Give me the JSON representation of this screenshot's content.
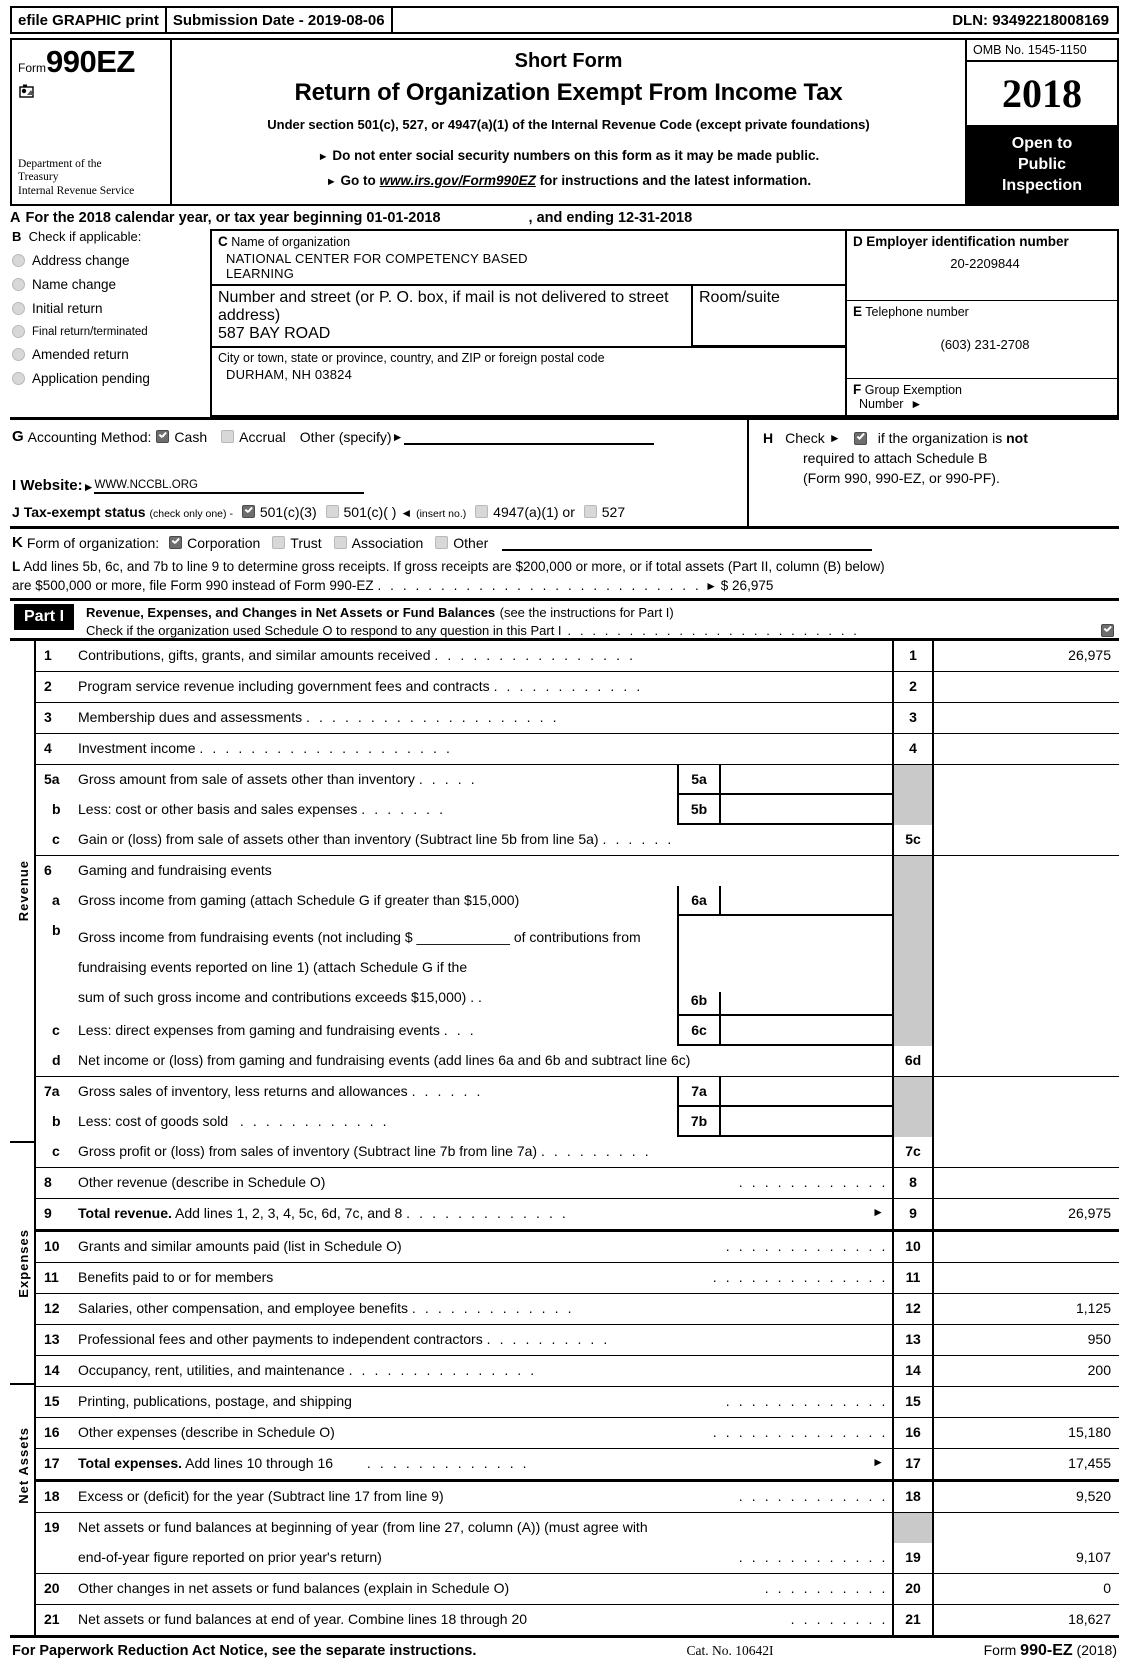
{
  "efile": {
    "graphic_print": "efile GRAPHIC print",
    "submission_date": "Submission Date - 2019-08-06",
    "dln": "DLN: 93492218008169"
  },
  "masthead": {
    "form_label": "Form",
    "form_number": "990EZ",
    "department_line1": "Department of the",
    "department_line2": "Treasury",
    "department_line3": "Internal Revenue Service",
    "short_form": "Short Form",
    "title": "Return of Organization Exempt From Income Tax",
    "under_section": "Under section 501(c), 527, or 4947(a)(1) of the Internal Revenue Code (except private foundations)",
    "bullet1": "Do not enter social security numbers on this form as it may be made public.",
    "bullet2_pre": "Go to ",
    "bullet2_link": "www.irs.gov/Form990EZ",
    "bullet2_post": " for instructions and the latest information.",
    "omb": "OMB No. 1545-1150",
    "year": "2018",
    "open_to": "Open to",
    "public": "Public",
    "inspection": "Inspection"
  },
  "lineA": {
    "letter": "A",
    "text_pre": "For the 2018 calendar year, or tax year beginning",
    "begin_date": "01-01-2018",
    "text_mid": ", and ending",
    "end_date": "12-31-2018"
  },
  "sectionB": {
    "letter": "B",
    "heading": "Check if applicable:",
    "items": [
      {
        "label": "Address change",
        "checked": false
      },
      {
        "label": "Name change",
        "checked": false
      },
      {
        "label": "Initial return",
        "checked": false
      },
      {
        "label": "Final return/terminated",
        "checked": false,
        "small": true
      },
      {
        "label": "Amended return",
        "checked": false
      },
      {
        "label": "Application pending",
        "checked": false
      }
    ]
  },
  "sectionC": {
    "letter": "C",
    "name_caption": "Name of organization",
    "org_name_line1": "NATIONAL CENTER FOR COMPETENCY BASED",
    "org_name_line2": "LEARNING",
    "street_caption": "Number and street (or P. O. box, if mail is not delivered to street address)",
    "room_caption": "Room/suite",
    "street": "587 BAY ROAD",
    "city_caption": "City or town, state or province, country, and ZIP or foreign postal code",
    "city": "DURHAM, NH  03824"
  },
  "sectionD": {
    "letter": "D",
    "caption": "Employer identification number",
    "value": "20-2209844"
  },
  "sectionE": {
    "letter": "E",
    "caption": "Telephone number",
    "value": "(603) 231-2708"
  },
  "sectionF": {
    "letter": "F",
    "caption_line1": "Group Exemption",
    "caption_line2": "Number"
  },
  "sectionG": {
    "letter": "G",
    "label": "Accounting Method:",
    "cash": "Cash",
    "cash_checked": true,
    "accrual": "Accrual",
    "accrual_checked": false,
    "other": "Other (specify)"
  },
  "sectionH": {
    "letter": "H",
    "check_label": "Check",
    "checked": true,
    "text1_pre": "if the organization is ",
    "text1_bold": "not",
    "text2": "required to attach Schedule B",
    "text3": "(Form 990, 990-EZ, or 990-PF)."
  },
  "sectionI": {
    "letter": "I",
    "label": "Website:",
    "value": "WWW.NCCBL.ORG"
  },
  "sectionJ": {
    "letter": "J",
    "label": "Tax-exempt status",
    "note": "(check only one) -",
    "opt1": "501(c)(3)",
    "opt1_checked": true,
    "opt2": "501(c)(   )",
    "opt2_checked": false,
    "insert": "(insert no.)",
    "opt3": "4947(a)(1) or",
    "opt3_checked": false,
    "opt4": "527",
    "opt4_checked": false
  },
  "sectionK": {
    "letter": "K",
    "label": "Form of organization:",
    "options": [
      {
        "label": "Corporation",
        "checked": true
      },
      {
        "label": "Trust",
        "checked": false
      },
      {
        "label": "Association",
        "checked": false
      },
      {
        "label": "Other",
        "checked": false
      }
    ]
  },
  "sectionL": {
    "letter": "L",
    "line1": "Add lines 5b, 6c, and 7b to line 9 to determine gross receipts. If gross receipts are $200,000 or more, or if total assets (Part II, column (B) below)",
    "line2": "are $500,000 or more, file Form 990 instead of Form 990-EZ",
    "amount_prefix": "$",
    "amount": "26,975"
  },
  "partI": {
    "tag": "Part I",
    "title": "Revenue, Expenses, and Changes in Net Assets or Fund Balances",
    "title_note": "(see the instructions for Part I)",
    "schedule_o_text": "Check if the organization used Schedule O to respond to any question in this Part I",
    "schedule_o_checked": true
  },
  "side_labels": {
    "revenue": "Revenue",
    "expenses": "Expenses",
    "net_assets": "Net Assets"
  },
  "revenue_lines": [
    {
      "no": "1",
      "desc": "Contributions, gifts, grants, and similar amounts received",
      "dots": ". . . . . . . . . . . . . . . .",
      "lno": "1",
      "amount": "26,975"
    },
    {
      "no": "2",
      "desc": "Program service revenue including government fees and contracts",
      "dots": ". . . . . . . . . . . .",
      "lno": "2",
      "amount": ""
    },
    {
      "no": "3",
      "desc": "Membership dues and assessments",
      "dots": ". . . . . . . . . . . . . . . . . . . .",
      "lno": "3",
      "amount": ""
    },
    {
      "no": "4",
      "desc": "Investment income",
      "dots": ". . . . . . . . . . . . . . . . . . . .",
      "lno": "4",
      "amount": ""
    },
    {
      "no": "5a",
      "desc": "Gross amount from sale of assets other than inventory",
      "dots": ". . . . .",
      "sub_no": "5a",
      "sub_amount": "",
      "lno": "",
      "gray": true,
      "amount": ""
    },
    {
      "no": "b",
      "desc": "Less: cost or other basis and sales expenses",
      "dots": ". . . . . . .",
      "sub_no": "5b",
      "sub_amount": "",
      "lno": "",
      "gray": true,
      "amount": ""
    },
    {
      "no": "c",
      "desc": "Gain or (loss) from sale of assets other than inventory (Subtract line 5b from line 5a)",
      "dots": ". . . . . .",
      "lno": "5c",
      "amount": ""
    },
    {
      "no": "6",
      "desc": "Gaming and fundraising events",
      "dots": "",
      "lno": "",
      "gray": true,
      "amount": ""
    },
    {
      "no": "a",
      "desc": "Gross income from gaming (attach Schedule G if greater than $15,000)",
      "dots": "",
      "sub_no": "6a",
      "sub_amount": "",
      "lno": "",
      "gray": true,
      "amount": ""
    },
    {
      "no": "b",
      "desc_multiline": [
        "Gross income from fundraising events (not including $ ____________ of contributions from",
        "fundraising events reported on line 1) (attach Schedule G if the",
        "sum of such gross income and contributions exceeds $15,000)     . ."
      ],
      "sub_no": "6b",
      "sub_amount": "",
      "lno": "",
      "gray": true,
      "amount": ""
    },
    {
      "no": "c",
      "desc": "Less: direct expenses from gaming and fundraising events",
      "dots": ". . .",
      "sub_no": "6c",
      "sub_amount": "",
      "lno": "",
      "gray": true,
      "amount": ""
    },
    {
      "no": "d",
      "desc": "Net income or (loss) from gaming and fundraising events (add lines 6a and 6b and subtract line 6c)",
      "dots": "",
      "lno": "6d",
      "amount": ""
    },
    {
      "no": "7a",
      "desc": "Gross sales of inventory, less returns and allowances",
      "dots": ". . . . . .",
      "sub_no": "7a",
      "sub_amount": "",
      "lno": "",
      "gray": true,
      "amount": ""
    },
    {
      "no": "b",
      "desc": "Less: cost of goods sold",
      "dots": ". . . . . . . . . . . .",
      "sub_no": "7b",
      "sub_amount": "",
      "lno": "",
      "gray": true,
      "amount": ""
    },
    {
      "no": "c",
      "desc": "Gross profit or (loss) from sales of inventory (Subtract line 7b from line 7a)",
      "dots": ". . . . . . . . .",
      "lno": "7c",
      "amount": ""
    },
    {
      "no": "8",
      "desc": "Other revenue (describe in Schedule O)",
      "dots": ". . . . . . . . . . . .",
      "lno": "8",
      "amount": ""
    },
    {
      "no": "9",
      "desc_bold": "Total revenue.",
      "desc": " Add lines 1, 2, 3, 4, 5c, 6d, 7c, and 8",
      "dots": ". . . . . . . . . . . . .",
      "arrow": true,
      "lno": "9",
      "amount": "26,975"
    }
  ],
  "expense_lines": [
    {
      "no": "10",
      "desc": "Grants and similar amounts paid (list in Schedule O)",
      "dots": ". . . . . . . . . . . . .",
      "lno": "10",
      "amount": ""
    },
    {
      "no": "11",
      "desc": "Benefits paid to or for members",
      "dots": ". . . . . . . . . . . . . .",
      "lno": "11",
      "amount": ""
    },
    {
      "no": "12",
      "desc": "Salaries, other compensation, and employee benefits",
      "dots": ". . . . . . . . . . . . .",
      "lno": "12",
      "amount": "1,125"
    },
    {
      "no": "13",
      "desc": "Professional fees and other payments to independent contractors",
      "dots": ". . . . . . . . . .",
      "lno": "13",
      "amount": "950"
    },
    {
      "no": "14",
      "desc": "Occupancy, rent, utilities, and maintenance",
      "dots": ". . . . . . . . . . . . . . .",
      "lno": "14",
      "amount": "200"
    },
    {
      "no": "15",
      "desc": "Printing, publications, postage, and shipping",
      "dots": ". . . . . . . . . . . . .",
      "lno": "15",
      "amount": ""
    },
    {
      "no": "16",
      "desc": "Other expenses (describe in Schedule O)",
      "dots": ". . . . . . . . . . . . . .",
      "lno": "16",
      "amount": "15,180"
    },
    {
      "no": "17",
      "desc_bold": "Total expenses.",
      "desc": " Add lines 10 through 16",
      "dots": ". . . . . . . . . . . . .",
      "arrow": true,
      "lno": "17",
      "amount": "17,455"
    }
  ],
  "netasset_lines": [
    {
      "no": "18",
      "desc": "Excess or (deficit) for the year (Subtract line 17 from line 9)",
      "dots": ". . . . . . . . . . . .",
      "lno": "18",
      "amount": "9,520"
    },
    {
      "no": "19",
      "desc": "Net assets or fund balances at beginning of year (from line 27, column (A)) (must agree with",
      "dots": "",
      "lno": "",
      "gray": true,
      "amount": ""
    },
    {
      "no": "",
      "desc": "end-of-year figure reported on prior year's return)",
      "dots": ". . . . . . . . . . . .",
      "lno": "19",
      "amount": "9,107"
    },
    {
      "no": "20",
      "desc": "Other changes in net assets or fund balances (explain in Schedule O)",
      "dots": ". . . . . . . . . .",
      "lno": "20",
      "amount": "0"
    },
    {
      "no": "21",
      "desc": "Net assets or fund balances at end of year. Combine lines 18 through 20",
      "dots": ". . . . . . . .",
      "lno": "21",
      "amount": "18,627"
    }
  ],
  "footer": {
    "left": "For Paperwork Reduction Act Notice, see the separate instructions.",
    "center": "Cat. No. 10642I",
    "right_pre": "Form ",
    "right_bold": "990-EZ",
    "right_post": " (2018)"
  }
}
